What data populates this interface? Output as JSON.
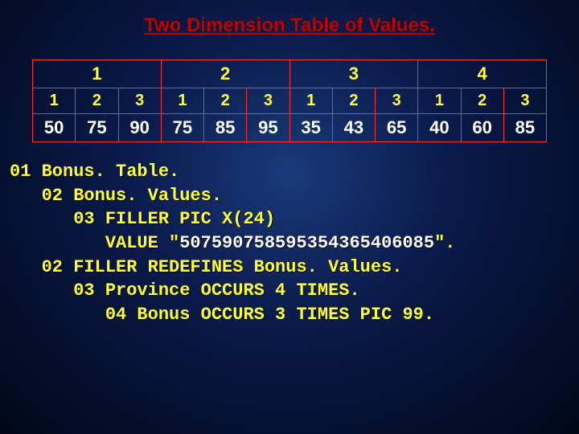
{
  "title": "Two Dimension Table of Values.",
  "table": {
    "group_headers": [
      "1",
      "2",
      "3",
      "4"
    ],
    "sub_headers": [
      "1",
      "2",
      "3",
      "1",
      "2",
      "3",
      "1",
      "2",
      "3",
      "1",
      "2",
      "3"
    ],
    "values": [
      "50",
      "75",
      "90",
      "75",
      "85",
      "95",
      "35",
      "43",
      "65",
      "40",
      "60",
      "85"
    ]
  },
  "code": {
    "l1": "01 Bonus. Table.",
    "l2": "   02 Bonus. Values.",
    "l3": "      03 FILLER PIC X(24)",
    "l4a": "         VALUE \"",
    "l4b": "507590758595354365406085",
    "l4c": "\".",
    "l5": "   02 FILLER REDEFINES Bonus. Values.",
    "l6": "      03 Province OCCURS 4 TIMES.",
    "l7": "         04 Bonus OCCURS 3 TIMES PIC 99."
  }
}
